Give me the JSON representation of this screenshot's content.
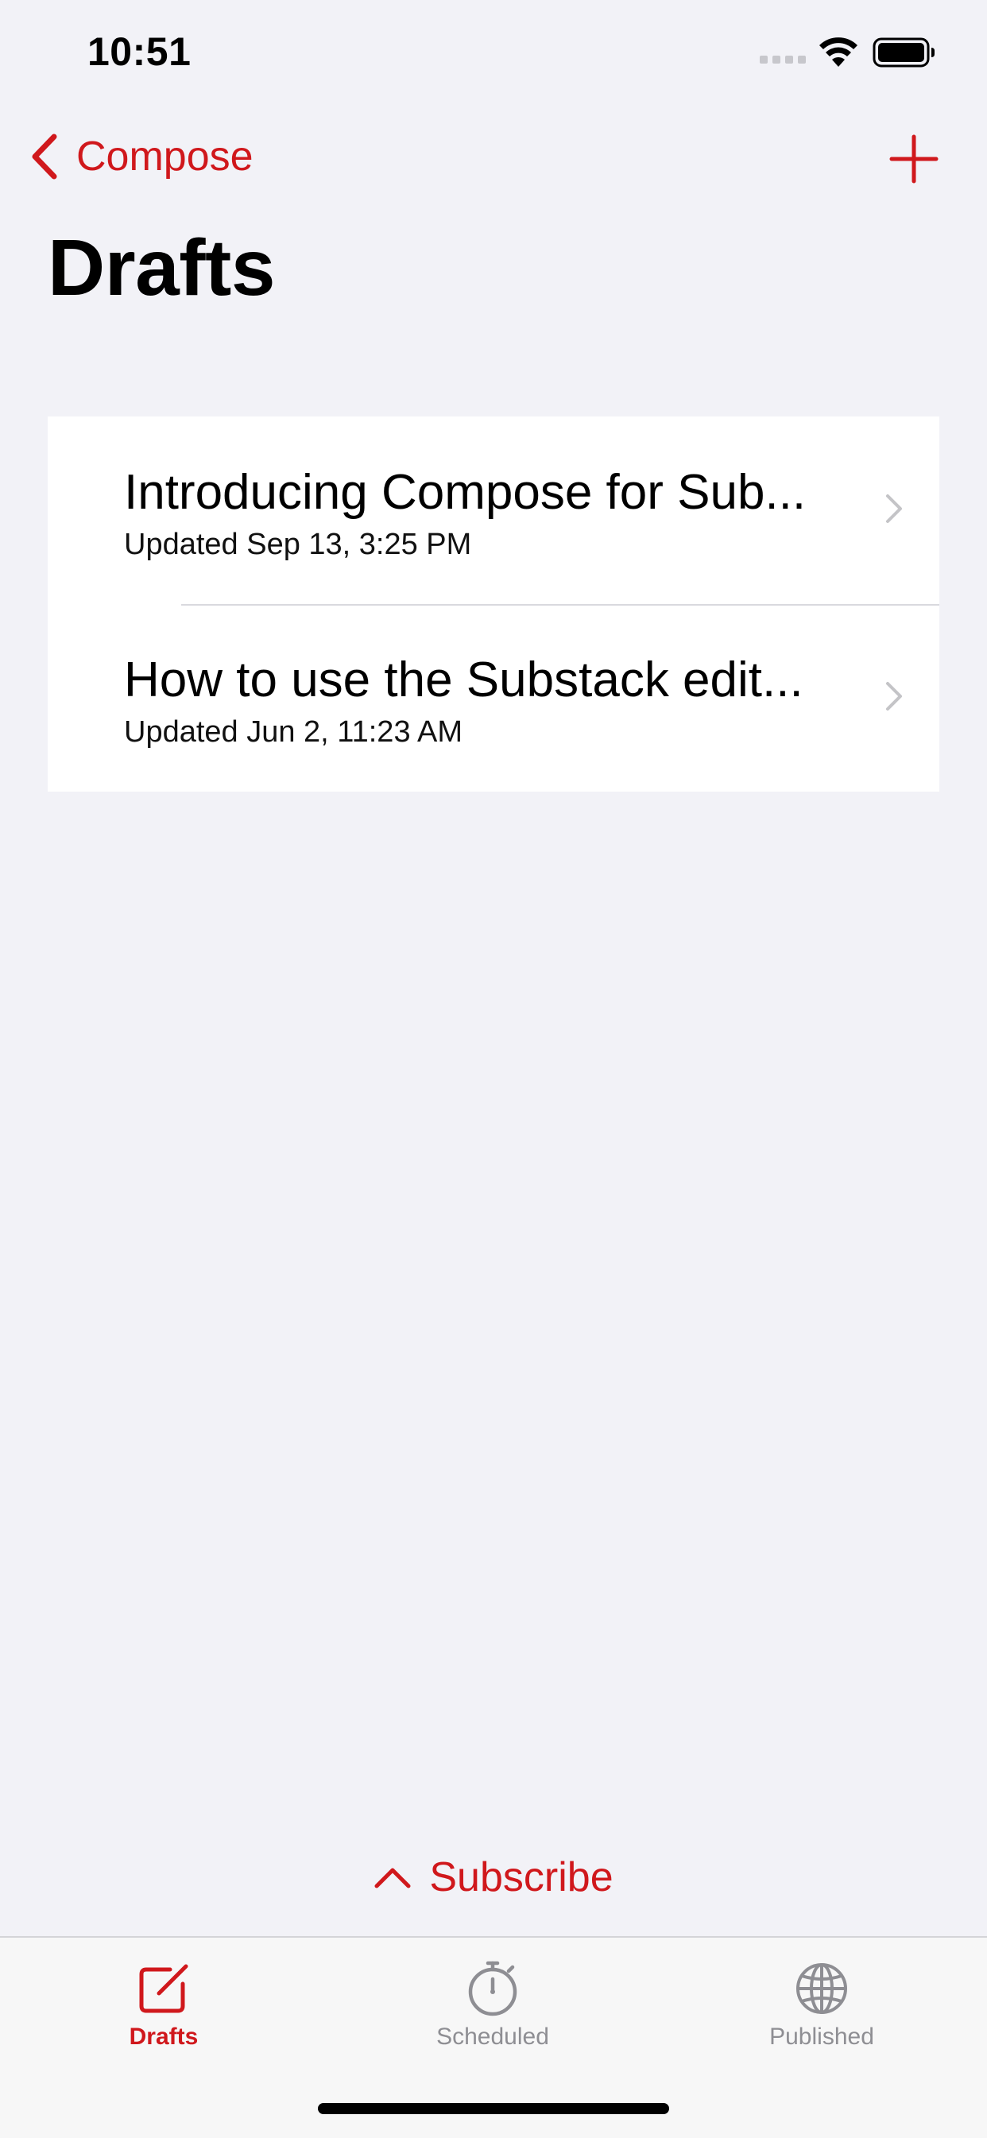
{
  "status_bar": {
    "time": "10:51",
    "icons": [
      "signal-icon",
      "wifi-icon",
      "battery-icon"
    ]
  },
  "nav": {
    "back_label": "Compose",
    "back_icon": "chevron-left-icon",
    "add_icon": "plus-icon"
  },
  "page": {
    "title": "Drafts"
  },
  "drafts": [
    {
      "title": "Introducing Compose for Sub...",
      "updated": "Updated Sep 13, 3:25 PM"
    },
    {
      "title": "How to use the Substack edit...",
      "updated": "Updated Jun 2, 11:23 AM"
    }
  ],
  "subscribe": {
    "label": "Subscribe",
    "icon": "chevron-up-icon"
  },
  "tabs": [
    {
      "label": "Drafts",
      "icon": "compose-icon",
      "active": true
    },
    {
      "label": "Scheduled",
      "icon": "stopwatch-icon",
      "active": false
    },
    {
      "label": "Published",
      "icon": "globe-icon",
      "active": false
    }
  ],
  "colors": {
    "accent": "#d0181c",
    "background": "#f2f2f7",
    "inactive_tab": "#8e8e93"
  }
}
